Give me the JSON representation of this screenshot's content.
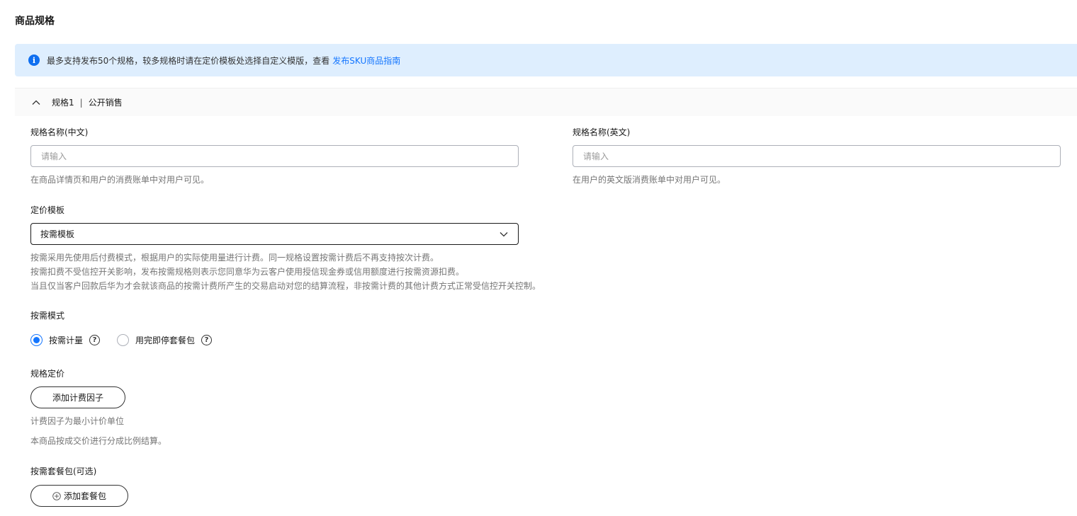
{
  "section": {
    "title": "商品规格"
  },
  "notice": {
    "text": "最多支持发布50个规格，较多规格时请在定价模板处选择自定义模版，查看",
    "link": "发布SKU商品指南"
  },
  "spec": {
    "header_name": "规格1",
    "header_separator": "|",
    "header_status": "公开销售",
    "name_cn": {
      "label": "规格名称(中文)",
      "placeholder": "请输入",
      "hint": "在商品详情页和用户的消费账单中对用户可见。"
    },
    "name_en": {
      "label": "规格名称(英文)",
      "placeholder": "请输入",
      "hint": "在用户的英文版消费账单中对用户可见。"
    },
    "pricing_template": {
      "label": "定价模板",
      "selected": "按需模板",
      "hints": [
        "按需采用先使用后付费模式，根据用户的实际使用量进行计费。同一规格设置按需计费后不再支持按次计费。",
        "按需扣费不受信控开关影响，发布按需规格则表示您同意华为云客户使用授信现金券或信用额度进行按需资源扣费。",
        "当且仅当客户回款后华为才会就该商品的按需计费所产生的交易启动对您的结算流程，非按需计费的其他计费方式正常受信控开关控制。"
      ]
    },
    "mode": {
      "label": "按需模式",
      "options": [
        {
          "label": "按需计量",
          "checked": true
        },
        {
          "label": "用完即停套餐包",
          "checked": false
        }
      ],
      "help_glyph": "?"
    },
    "pricing": {
      "label": "规格定价",
      "add_button": "添加计费因子",
      "hint1": "计费因子为最小计价单位",
      "hint2": "本商品按成交价进行分成比例结算。"
    },
    "package": {
      "label": "按需套餐包(可选)",
      "add_button": "添加套餐包"
    }
  },
  "colors": {
    "accent": "#1476ff",
    "notice_bg": "#deeefe",
    "info_icon": "#0f6ff0"
  }
}
